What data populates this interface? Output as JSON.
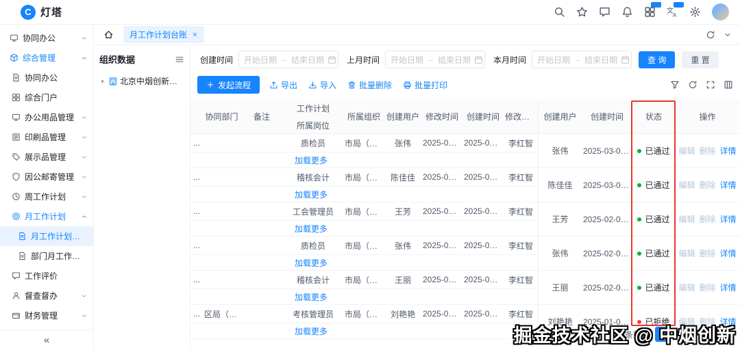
{
  "topbar": {
    "brand": "灯塔",
    "logo_glyph": "C",
    "icons": [
      {
        "name": "search-icon",
        "icon": "search"
      },
      {
        "name": "star-icon",
        "icon": "star"
      },
      {
        "name": "comment-icon",
        "icon": "comment"
      },
      {
        "name": "bell-icon",
        "icon": "bell"
      },
      {
        "name": "apps-icon",
        "icon": "apps",
        "badge": true
      },
      {
        "name": "translate-icon",
        "icon": "translate",
        "badge": true
      },
      {
        "name": "gear-icon",
        "icon": "gear"
      }
    ]
  },
  "sidebar": {
    "collapse_glyph": "«",
    "items": [
      {
        "label": "协同办公",
        "icon": "monitor",
        "level": 0,
        "chevron": "down"
      },
      {
        "label": "综合管理",
        "icon": "cube",
        "level": 0,
        "chevron": "up",
        "active": true
      },
      {
        "label": "协同办公",
        "icon": "doc",
        "level": 1
      },
      {
        "label": "综合门户",
        "icon": "grid",
        "level": 1
      },
      {
        "label": "办公用品管理",
        "icon": "monitor",
        "level": 1,
        "chevron": "down"
      },
      {
        "label": "印刷品管理",
        "icon": "list",
        "level": 1,
        "chevron": "down"
      },
      {
        "label": "展示品管理",
        "icon": "tag",
        "level": 1,
        "chevron": "down"
      },
      {
        "label": "因公邮寄管理",
        "icon": "shield",
        "level": 1,
        "chevron": "down"
      },
      {
        "label": "周工作计划",
        "icon": "clock",
        "level": 1,
        "chevron": "down"
      },
      {
        "label": "月工作计划",
        "icon": "target",
        "level": 1,
        "chevron": "up",
        "active": true
      },
      {
        "label": "月工作计划台账",
        "icon": "doc",
        "level": 2,
        "selected": true
      },
      {
        "label": "部门月工作计划(...",
        "icon": "doc",
        "level": 2
      },
      {
        "label": "工作评价",
        "icon": "comment",
        "level": 1
      },
      {
        "label": "督查督办",
        "icon": "user",
        "level": 1,
        "chevron": "down"
      },
      {
        "label": "财务管理",
        "icon": "wallet",
        "level": 1,
        "chevron": "down"
      }
    ]
  },
  "tabs": {
    "active_tab": "月工作计划台账"
  },
  "org_panel": {
    "title": "组织数据",
    "node": "北京中烟创新科技有限..."
  },
  "filters": [
    {
      "label": "创建时间",
      "start": "开始日期",
      "end": "结束日期"
    },
    {
      "label": "上月时间",
      "start": "开始日期",
      "end": "结束日期"
    },
    {
      "label": "本月时间",
      "start": "开始日期",
      "end": "结束日期"
    }
  ],
  "filter_buttons": {
    "query": "查 询",
    "reset": "重 置"
  },
  "toolbar": {
    "primary": "发起流程",
    "actions": [
      {
        "label": "导出",
        "icon": "export",
        "name": "export-button"
      },
      {
        "label": "导入",
        "icon": "import",
        "name": "import-button"
      },
      {
        "label": "批量删除",
        "icon": "delete",
        "name": "batch-delete-button"
      },
      {
        "label": "批量打印",
        "icon": "print",
        "name": "batch-print-button"
      }
    ]
  },
  "table": {
    "group_header": "工作计划",
    "columns": [
      "",
      "协同部门",
      "备注",
      "所属岗位",
      "所属组织",
      "创建用户",
      "修改时间",
      "创建时间",
      "修改用户",
      "创建用户",
      "创建时间",
      "状态",
      "操作"
    ],
    "load_more": "加载更多",
    "action_links": [
      {
        "label": "编辑",
        "name": "edit-link",
        "muted": true
      },
      {
        "label": "删除",
        "name": "delete-link",
        "muted": true
      },
      {
        "label": "详情",
        "name": "detail-link",
        "muted": false
      }
    ],
    "status_colors": {
      "pass": "#00b42a",
      "reject": "#f53f3f"
    },
    "rows": [
      {
        "overflow": "...",
        "dept": "",
        "note": "",
        "position": "质检员",
        "org": "市局（公司...",
        "user": "张伟",
        "modified": "2025-03-05...",
        "created": "2025-03-03...",
        "mod_user": "李红智",
        "creator": "张伟",
        "create_time": "2025-03-03...",
        "status": "已通过",
        "status_type": "pass"
      },
      {
        "overflow": "...",
        "dept": "",
        "note": "",
        "position": "稽核会计",
        "org": "市局（公司...",
        "user": "陈佳佳",
        "modified": "2025-03-05...",
        "created": "2025-03-03...",
        "mod_user": "李红智",
        "creator": "陈佳佳",
        "create_time": "2025-03-03...",
        "status": "已通过",
        "status_type": "pass"
      },
      {
        "overflow": "...",
        "dept": "",
        "note": "",
        "position": "工会管理员",
        "org": "市局（公司...",
        "user": "王芳",
        "modified": "2025-03-05...",
        "created": "2025-02-08...",
        "mod_user": "李红智",
        "creator": "王芳",
        "create_time": "2025-02-08...",
        "status": "已通过",
        "status_type": "pass"
      },
      {
        "overflow": "...",
        "dept": "",
        "note": "",
        "position": "质检员",
        "org": "市局（公司...",
        "user": "张伟",
        "modified": "2025-03-05...",
        "created": "2025-02-05...",
        "mod_user": "李红智",
        "creator": "张伟",
        "create_time": "2025-02-05...",
        "status": "已通过",
        "status_type": "pass"
      },
      {
        "overflow": "...",
        "dept": "",
        "note": "",
        "position": "稽核会计",
        "org": "市局（公司...",
        "user": "王丽",
        "modified": "2025-03-05...",
        "created": "2025-02-05...",
        "mod_user": "李红智",
        "creator": "王丽",
        "create_time": "2025-02-05...",
        "status": "已通过",
        "status_type": "pass"
      },
      {
        "overflow": "...",
        "dept": "区局（营销...",
        "note": "",
        "position": "考核管理员",
        "org": "市局（公司...",
        "user": "刘艳艳",
        "modified": "2025-03-05...",
        "created": "2025-01-08...",
        "mod_user": "李红智",
        "creator": "刘艳艳",
        "create_time": "2025-01-08...",
        "status": "已拒绝",
        "status_type": "reject"
      }
    ]
  },
  "pagination": {
    "suffix": "条数据",
    "page": "1"
  },
  "watermark": "掘金技术社区 @ 中烟创新",
  "colors": {
    "primary": "#1684fc",
    "highlight_bg": "#e8f3ff",
    "annotation": "#e8352e"
  }
}
